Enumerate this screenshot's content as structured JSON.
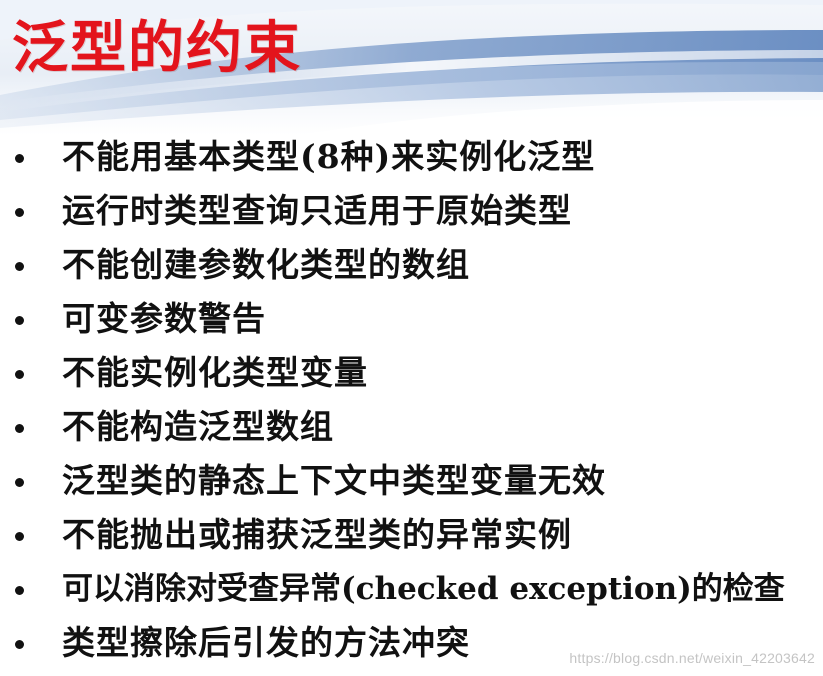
{
  "slide": {
    "title": "泛型的约束",
    "bullets": [
      "不能用基本类型(8种)来实例化泛型",
      "运行时类型查询只适用于原始类型",
      "不能创建参数化类型的数组",
      "可变参数警告",
      "不能实例化类型变量",
      "不能构造泛型数组",
      "泛型类的静态上下文中类型变量无效",
      "不能抛出或捕获泛型类的异常实例",
      "可以消除对受查异常(checked exception)的检查",
      "类型擦除后引发的方法冲突"
    ],
    "watermark": "https://blog.csdn.net/weixin_42203642"
  },
  "colors": {
    "title": "#e3141c",
    "text": "#111111",
    "header_blue": "#9fb6d8",
    "watermark": "#c4c4c4"
  }
}
